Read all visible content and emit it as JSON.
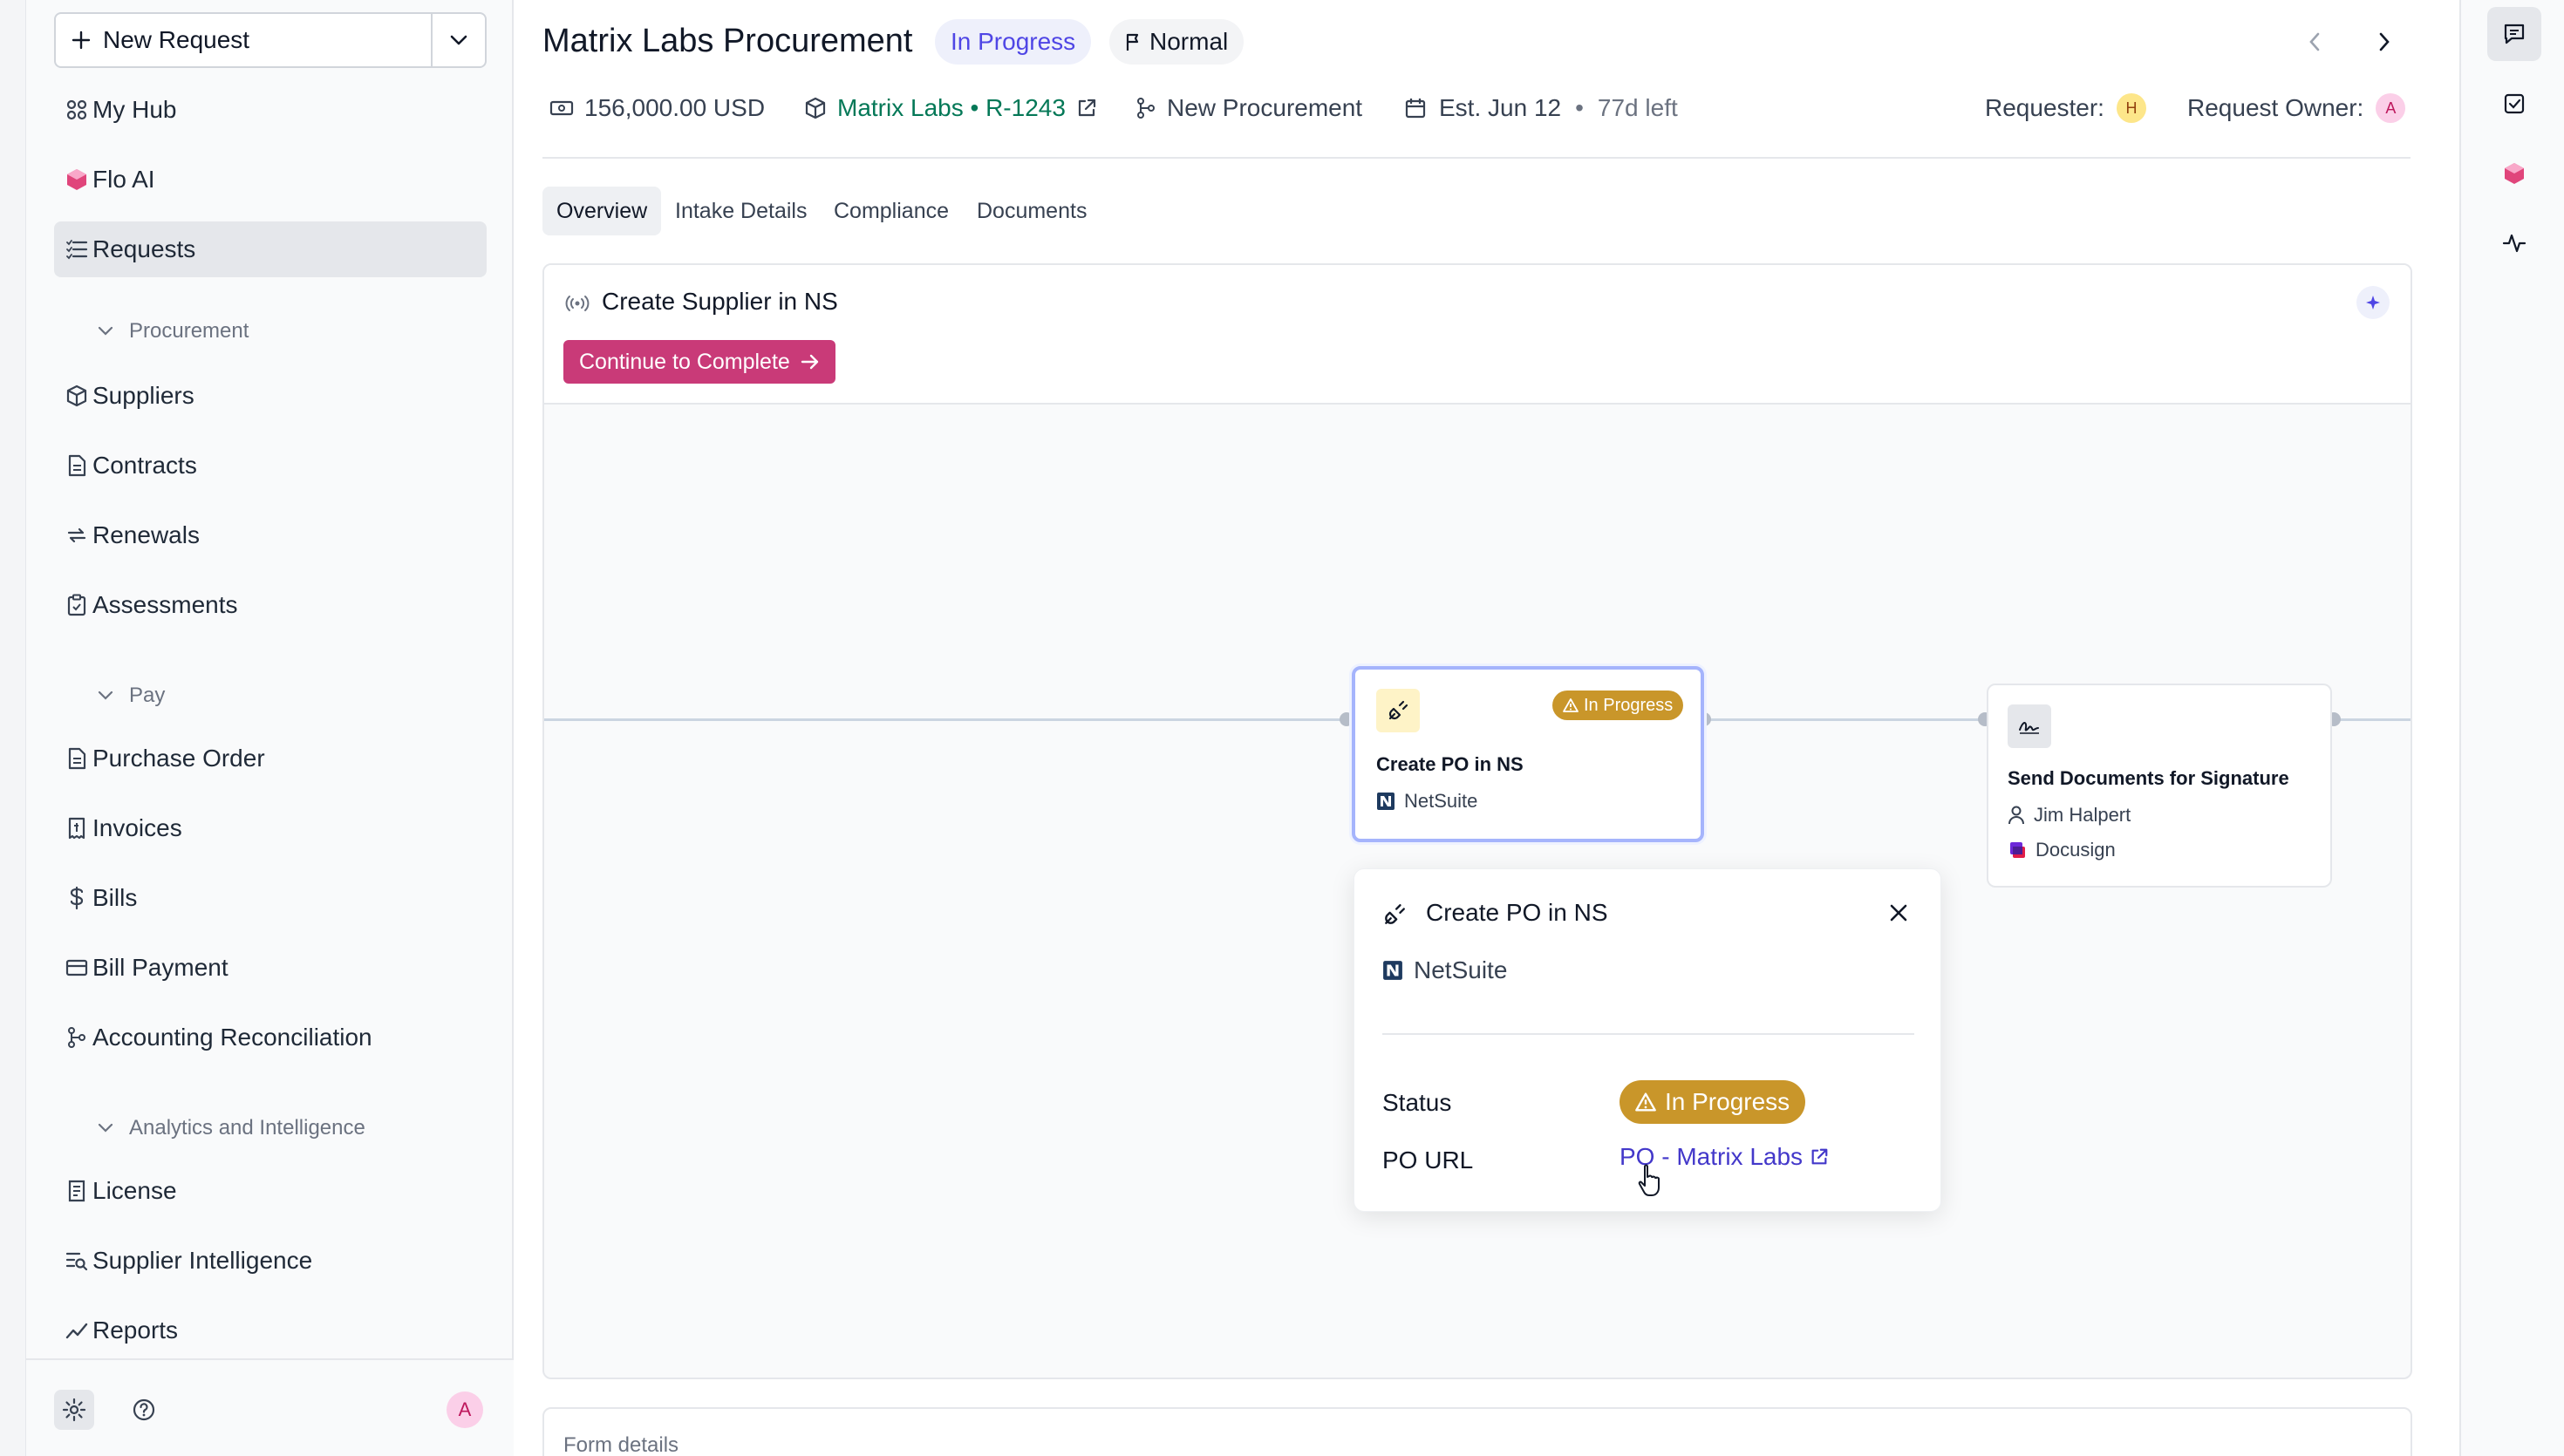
{
  "sidebar": {
    "new_request_label": "New Request",
    "items": {
      "my_hub": "My Hub",
      "flo_ai": "Flo AI",
      "requests": "Requests",
      "suppliers": "Suppliers",
      "contracts": "Contracts",
      "renewals": "Renewals",
      "assessments": "Assessments",
      "purchase_order": "Purchase Order",
      "invoices": "Invoices",
      "bills": "Bills",
      "bill_payment": "Bill Payment",
      "accounting_reconciliation": "Accounting Reconciliation",
      "license": "License",
      "supplier_intelligence": "Supplier Intelligence",
      "reports": "Reports"
    },
    "sections": {
      "procurement": "Procurement",
      "pay": "Pay",
      "analytics": "Analytics and Intelligence"
    },
    "user_initial": "A"
  },
  "header": {
    "title": "Matrix Labs Procurement",
    "status": "In Progress",
    "priority": "Normal",
    "amount": "156,000.00 USD",
    "supplier_ref": "Matrix Labs • R-1243",
    "workflow": "New Procurement",
    "est": "Est. Jun 12",
    "dot": "•",
    "left": "77d left",
    "requester_label": "Requester:",
    "requester_initial": "H",
    "owner_label": "Request Owner:",
    "owner_initial": "A"
  },
  "tabs": [
    "Overview",
    "Intake Details",
    "Compliance",
    "Documents"
  ],
  "stage": {
    "title": "Create Supplier in NS",
    "continue_label": "Continue to Complete",
    "plus": "+"
  },
  "nodes": {
    "po": {
      "badge": "In Progress",
      "name": "Create PO in NS",
      "system": "NetSuite"
    },
    "sign": {
      "name": "Send Documents for Signature",
      "assignee": "Jim Halpert",
      "system": "Docusign"
    }
  },
  "popover": {
    "title": "Create PO in NS",
    "system": "NetSuite",
    "status_label": "Status",
    "status_value": "In Progress",
    "url_label": "PO URL",
    "url_value": "PO - Matrix Labs"
  },
  "form_details": "Form details",
  "colors": {
    "accent": "#4f46e5",
    "primary_button": "#c93a78",
    "warning": "#c9962a",
    "supplier_link": "#047857"
  }
}
